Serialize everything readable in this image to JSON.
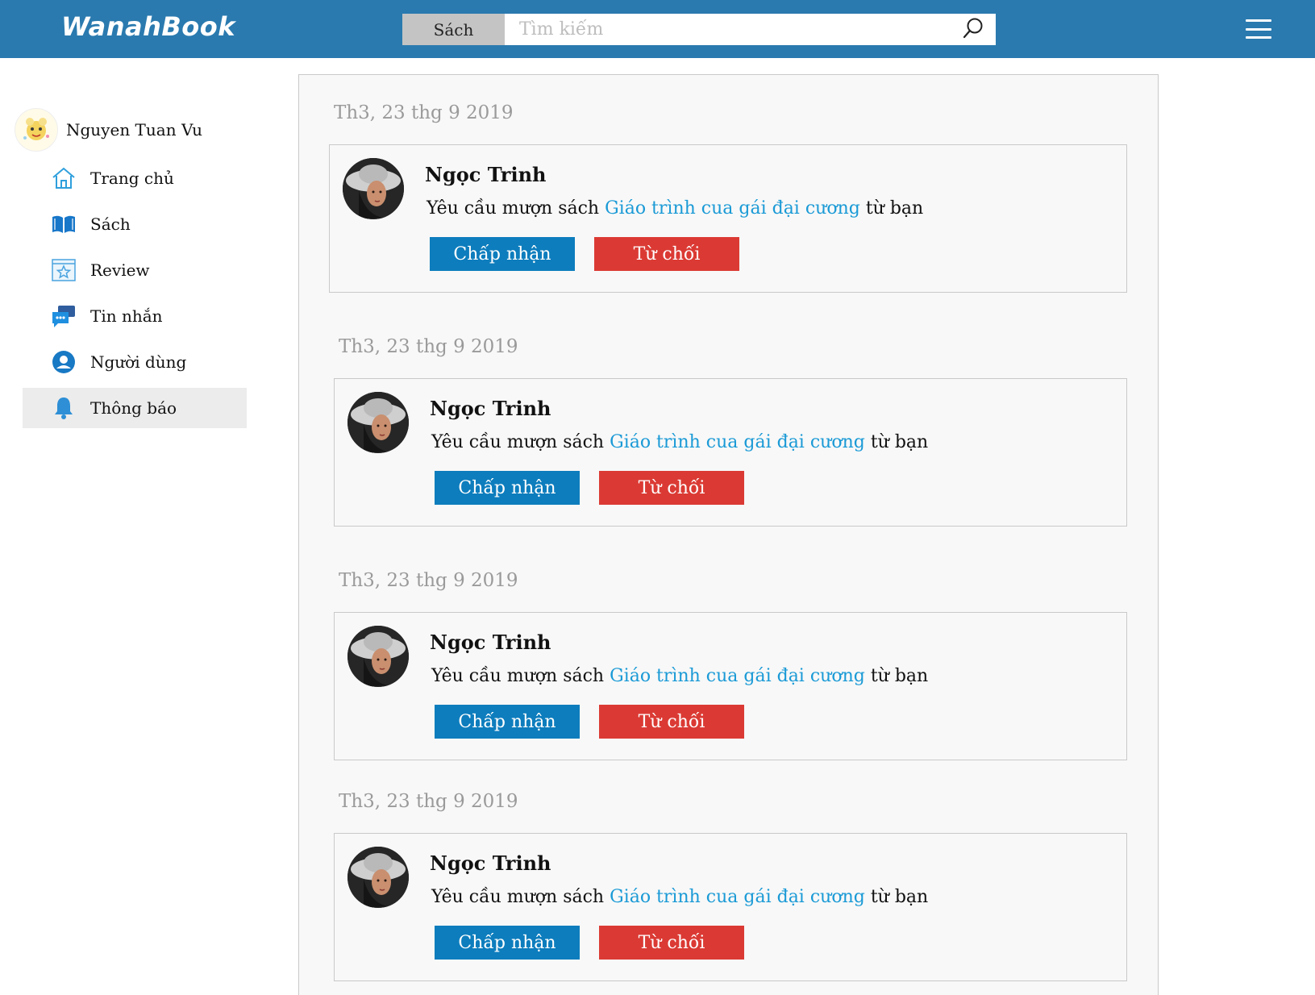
{
  "header": {
    "logo": "WanahBook",
    "search_category": "Sách",
    "search_placeholder": "Tìm kiếm"
  },
  "sidebar": {
    "user_name": "Nguyen Tuan Vu",
    "items": [
      {
        "label": "Trang chủ",
        "icon": "home-icon",
        "active": false
      },
      {
        "label": "Sách",
        "icon": "book-icon",
        "active": false
      },
      {
        "label": "Review",
        "icon": "review-star-icon",
        "active": false
      },
      {
        "label": "Tin nhắn",
        "icon": "chat-icon",
        "active": false
      },
      {
        "label": "Người dùng",
        "icon": "user-icon",
        "active": false
      },
      {
        "label": "Thông báo",
        "icon": "bell-icon",
        "active": true
      }
    ]
  },
  "notifications": [
    {
      "date": "Th3, 23 thg 9 2019",
      "sender": "Ngọc Trinh",
      "message_prefix": "Yêu cầu mượn sách",
      "book_title": "Giáo trình cua gái đại cương",
      "message_suffix": "từ bạn",
      "accept_label": "Chấp nhận",
      "reject_label": "Từ chối"
    },
    {
      "date": "Th3, 23 thg 9 2019",
      "sender": "Ngọc Trinh",
      "message_prefix": "Yêu cầu mượn sách",
      "book_title": "Giáo trình cua gái đại cương",
      "message_suffix": "từ bạn",
      "accept_label": "Chấp nhận",
      "reject_label": "Từ chối"
    },
    {
      "date": "Th3, 23 thg 9 2019",
      "sender": "Ngọc Trinh",
      "message_prefix": "Yêu cầu mượn sách",
      "book_title": "Giáo trình cua gái đại cương",
      "message_suffix": "từ bạn",
      "accept_label": "Chấp nhận",
      "reject_label": "Từ chối"
    },
    {
      "date": "Th3, 23 thg 9 2019",
      "sender": "Ngọc Trinh",
      "message_prefix": "Yêu cầu mượn sách",
      "book_title": "Giáo trình cua gái đại cương",
      "message_suffix": "từ bạn",
      "accept_label": "Chấp nhận",
      "reject_label": "Từ chối"
    }
  ],
  "colors": {
    "header_bg": "#2a7aaf",
    "accept": "#0d7dbd",
    "reject": "#db3a34",
    "link": "#1a9ad6"
  }
}
